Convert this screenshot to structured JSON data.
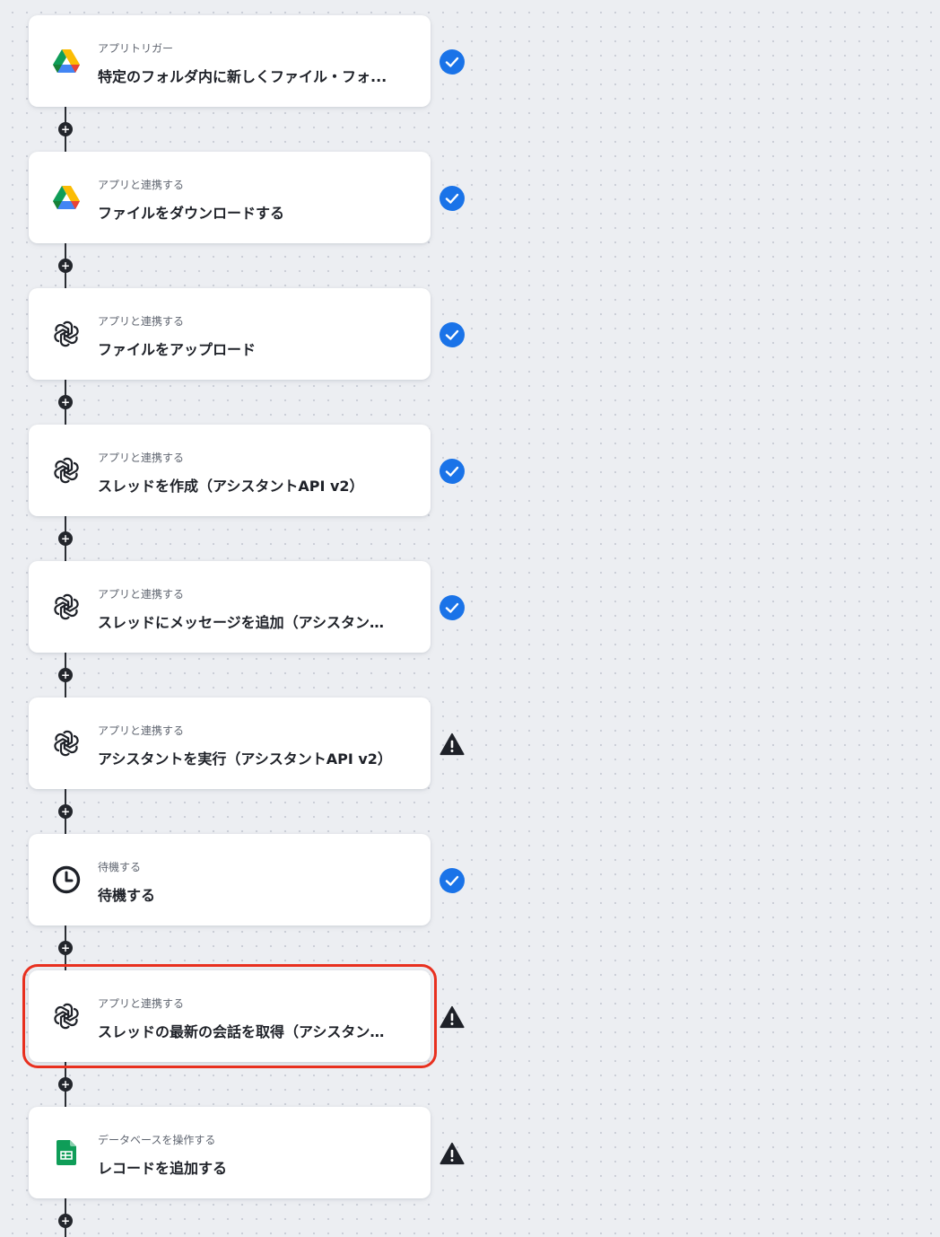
{
  "steps": [
    {
      "icon": "google-drive-icon",
      "subtitle": "アプリトリガー",
      "title": "特定のフォルダ内に新しくファイル・フォ...",
      "status": "success"
    },
    {
      "icon": "google-drive-icon",
      "subtitle": "アプリと連携する",
      "title": "ファイルをダウンロードする",
      "status": "success"
    },
    {
      "icon": "openai-icon",
      "subtitle": "アプリと連携する",
      "title": "ファイルをアップロード",
      "status": "success"
    },
    {
      "icon": "openai-icon",
      "subtitle": "アプリと連携する",
      "title": "スレッドを作成（アシスタントAPI v2）",
      "status": "success"
    },
    {
      "icon": "openai-icon",
      "subtitle": "アプリと連携する",
      "title": "スレッドにメッセージを追加（アシスタントA...",
      "status": "success"
    },
    {
      "icon": "openai-icon",
      "subtitle": "アプリと連携する",
      "title": "アシスタントを実行（アシスタントAPI v2）",
      "status": "warning"
    },
    {
      "icon": "clock-icon",
      "subtitle": "待機する",
      "title": "待機する",
      "status": "success"
    },
    {
      "icon": "openai-icon",
      "subtitle": "アプリと連携する",
      "title": "スレッドの最新の会話を取得（アシスタント...",
      "status": "warning",
      "highlighted": true
    },
    {
      "icon": "google-sheets-icon",
      "subtitle": "データベースを操作する",
      "title": "レコードを追加する",
      "status": "warning"
    }
  ],
  "add_step_symbol": "+",
  "colors": {
    "success": "#1a73e8",
    "warning": "#1e2128",
    "highlight_border": "#e8301f",
    "sheets_green": "#0f9d58"
  }
}
